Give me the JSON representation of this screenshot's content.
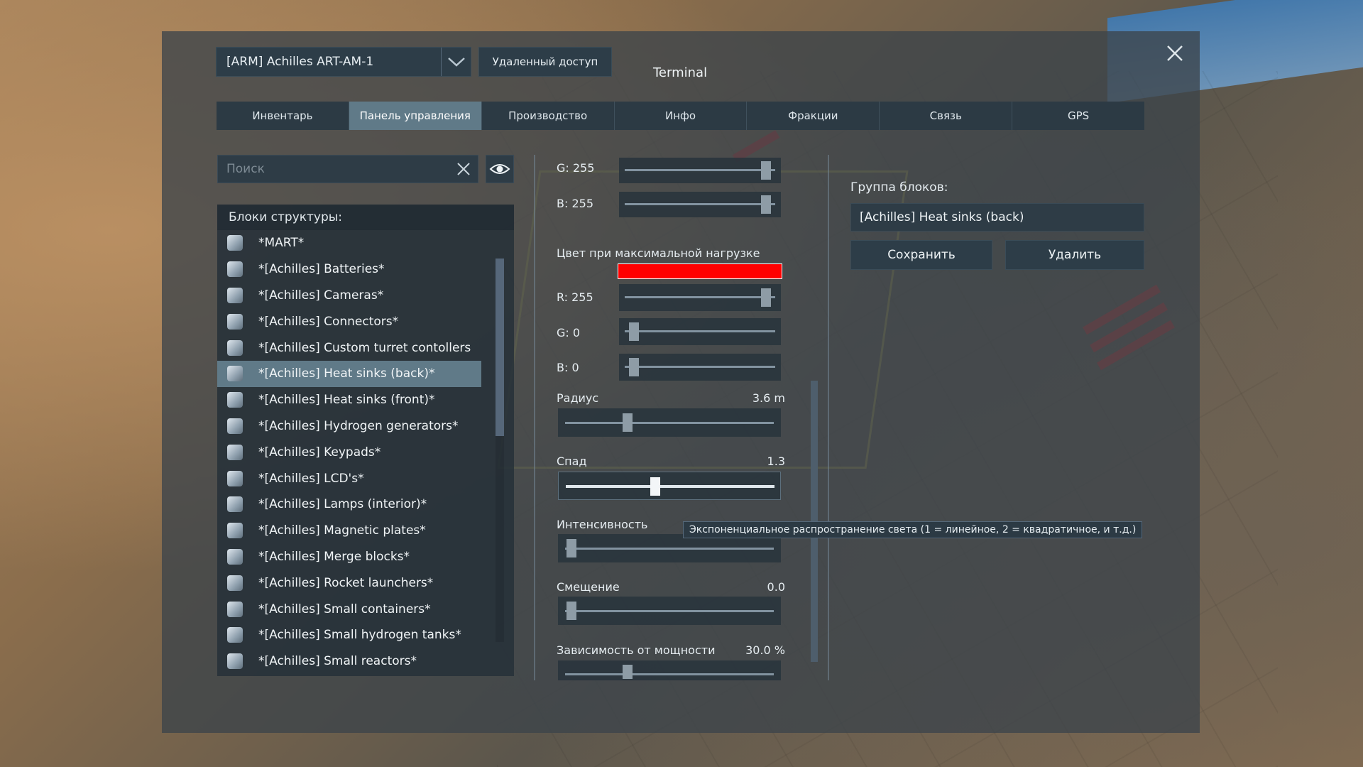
{
  "window": {
    "grid_selector_value": "[ARM] Achilles ART-AM-1",
    "remote_access_label": "Удаленный доступ",
    "title": "Terminal"
  },
  "tabs": [
    {
      "label": "Инвентарь",
      "active": false
    },
    {
      "label": "Панель управления",
      "active": true
    },
    {
      "label": "Производство",
      "active": false
    },
    {
      "label": "Инфо",
      "active": false
    },
    {
      "label": "Фракции",
      "active": false
    },
    {
      "label": "Связь",
      "active": false
    },
    {
      "label": "GPS",
      "active": false
    }
  ],
  "search": {
    "placeholder": "Поиск",
    "value": ""
  },
  "blocks": {
    "header": "Блоки структуры:",
    "items": [
      {
        "label": "*MART*",
        "icon": "block-group-icon",
        "selected": false
      },
      {
        "label": "*[Achilles] Batteries*",
        "icon": "battery-icon",
        "selected": false
      },
      {
        "label": "*[Achilles] Cameras*",
        "icon": "camera-icon",
        "selected": false
      },
      {
        "label": "*[Achilles] Connectors*",
        "icon": "connector-icon",
        "selected": false
      },
      {
        "label": "*[Achilles] Custom turret contollers",
        "icon": "turret-controller-icon",
        "selected": false
      },
      {
        "label": "*[Achilles] Heat sinks (back)*",
        "icon": "heat-sink-icon",
        "selected": true
      },
      {
        "label": "*[Achilles] Heat sinks (front)*",
        "icon": "heat-sink-icon",
        "selected": false
      },
      {
        "label": "*[Achilles] Hydrogen generators*",
        "icon": "hydrogen-generator-icon",
        "selected": false
      },
      {
        "label": "*[Achilles] Keypads*",
        "icon": "keypad-icon",
        "selected": false
      },
      {
        "label": "*[Achilles] LCD's*",
        "icon": "lcd-icon",
        "selected": false
      },
      {
        "label": "*[Achilles] Lamps (interior)*",
        "icon": "lamp-icon",
        "selected": false
      },
      {
        "label": "*[Achilles] Magnetic plates*",
        "icon": "magnetic-plate-icon",
        "selected": false
      },
      {
        "label": "*[Achilles] Merge blocks*",
        "icon": "merge-block-icon",
        "selected": false
      },
      {
        "label": "*[Achilles] Rocket launchers*",
        "icon": "rocket-launcher-icon",
        "selected": false
      },
      {
        "label": "*[Achilles] Small containers*",
        "icon": "container-icon",
        "selected": false
      },
      {
        "label": "*[Achilles] Small hydrogen tanks*",
        "icon": "hydrogen-tank-icon",
        "selected": false
      },
      {
        "label": "*[Achilles] Small reactors*",
        "icon": "reactor-icon",
        "selected": false
      }
    ]
  },
  "controls": {
    "g_top_label": "G: 255",
    "g_top_value": 255,
    "b_top_label": "B: 255",
    "b_top_value": 255,
    "max_load_color_label": "Цвет при максимальной нагрузке",
    "max_load_color": "#ff0000",
    "r_label": "R: 255",
    "r_value": 255,
    "g_label": "G: 0",
    "g_value": 0,
    "b_label": "B: 0",
    "b_value": 0,
    "radius_label": "Радиус",
    "radius_value": "3.6 m",
    "radius_fraction": 0.3,
    "falloff_label": "Спад",
    "falloff_value": "1.3",
    "falloff_fraction": 0.43,
    "intensity_label": "Интенсивность",
    "intensity_fraction": 0.03,
    "offset_label": "Смещение",
    "offset_value": "0.0",
    "offset_fraction": 0.03,
    "power_dependency_label": "Зависимость от мощности",
    "power_dependency_value": "30.0 %",
    "power_dependency_fraction": 0.3,
    "tooltip": "Экспоненциальное распространение света (1 = линейное, 2 = квадратичное, и т.д.)"
  },
  "group": {
    "label": "Группа блоков:",
    "name_value": "[Achilles] Heat sinks (back)",
    "save_label": "Сохранить",
    "delete_label": "Удалить"
  },
  "colors": {
    "selected_row": "#607a88",
    "active_tab": "#607a88",
    "swatch": "#ff0000"
  }
}
